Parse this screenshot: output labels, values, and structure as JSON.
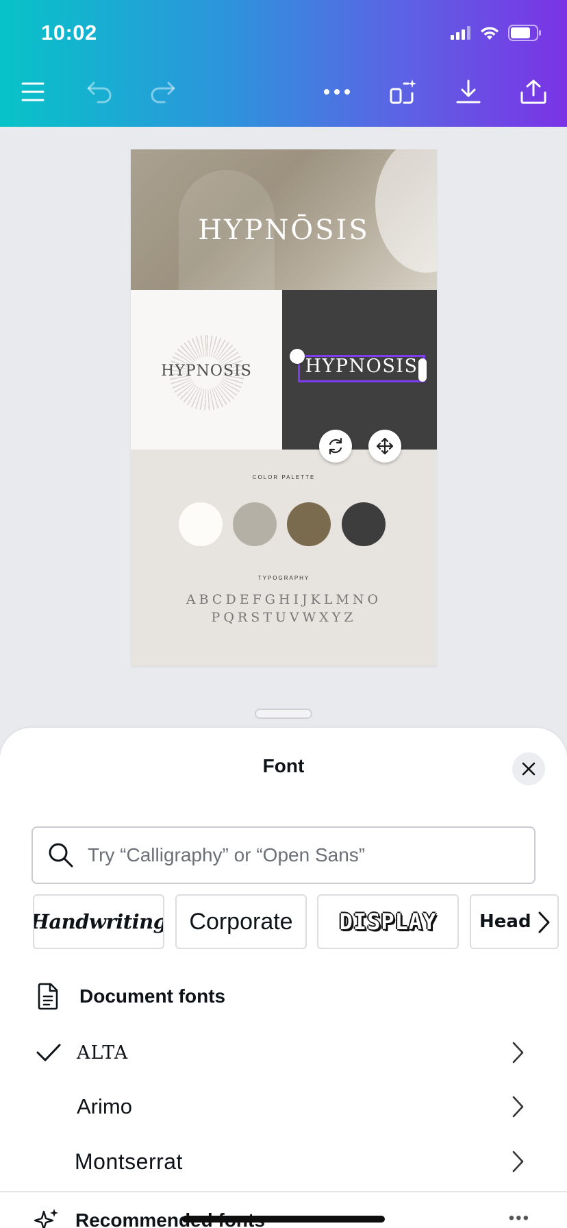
{
  "status_bar": {
    "time": "10:02"
  },
  "toolbar": {
    "icons": [
      "menu-icon",
      "undo-icon",
      "redo-icon",
      "more-icon",
      "magic-resize-icon",
      "download-icon",
      "share-icon"
    ]
  },
  "design": {
    "hero_title": "HYPNŌSIS",
    "logo_light": "HYPNOSIS",
    "logo_dark": "HYPNŌSIS",
    "palette_label": "COLOR PALETTE",
    "palette_colors": [
      "#fdfcf8",
      "#b4b0a6",
      "#7a6a4e",
      "#3d3d3d"
    ],
    "typography_label": "TYPOGRAPHY",
    "alphabet_line1": "ABCDEFGHIJKLMNO",
    "alphabet_line2": "PQRSTUVWXYZ"
  },
  "font_panel": {
    "title": "Font",
    "search_placeholder": "Try “Calligraphy” or “Open Sans”",
    "categories": [
      {
        "label": "Handwriting"
      },
      {
        "label": "Corporate"
      },
      {
        "label": "DISPLAY"
      },
      {
        "label": "Head"
      }
    ],
    "document_fonts_heading": "Document fonts",
    "document_fonts": [
      {
        "name": "ALTA",
        "selected": true
      },
      {
        "name": "Arimo",
        "selected": false
      },
      {
        "name": "Montserrat",
        "selected": false
      }
    ],
    "recommended_heading": "Recommended fonts"
  },
  "colors": {
    "accent": "#7d3cf0",
    "gradient_start": "#07c3c8",
    "gradient_end": "#7b33e5"
  }
}
